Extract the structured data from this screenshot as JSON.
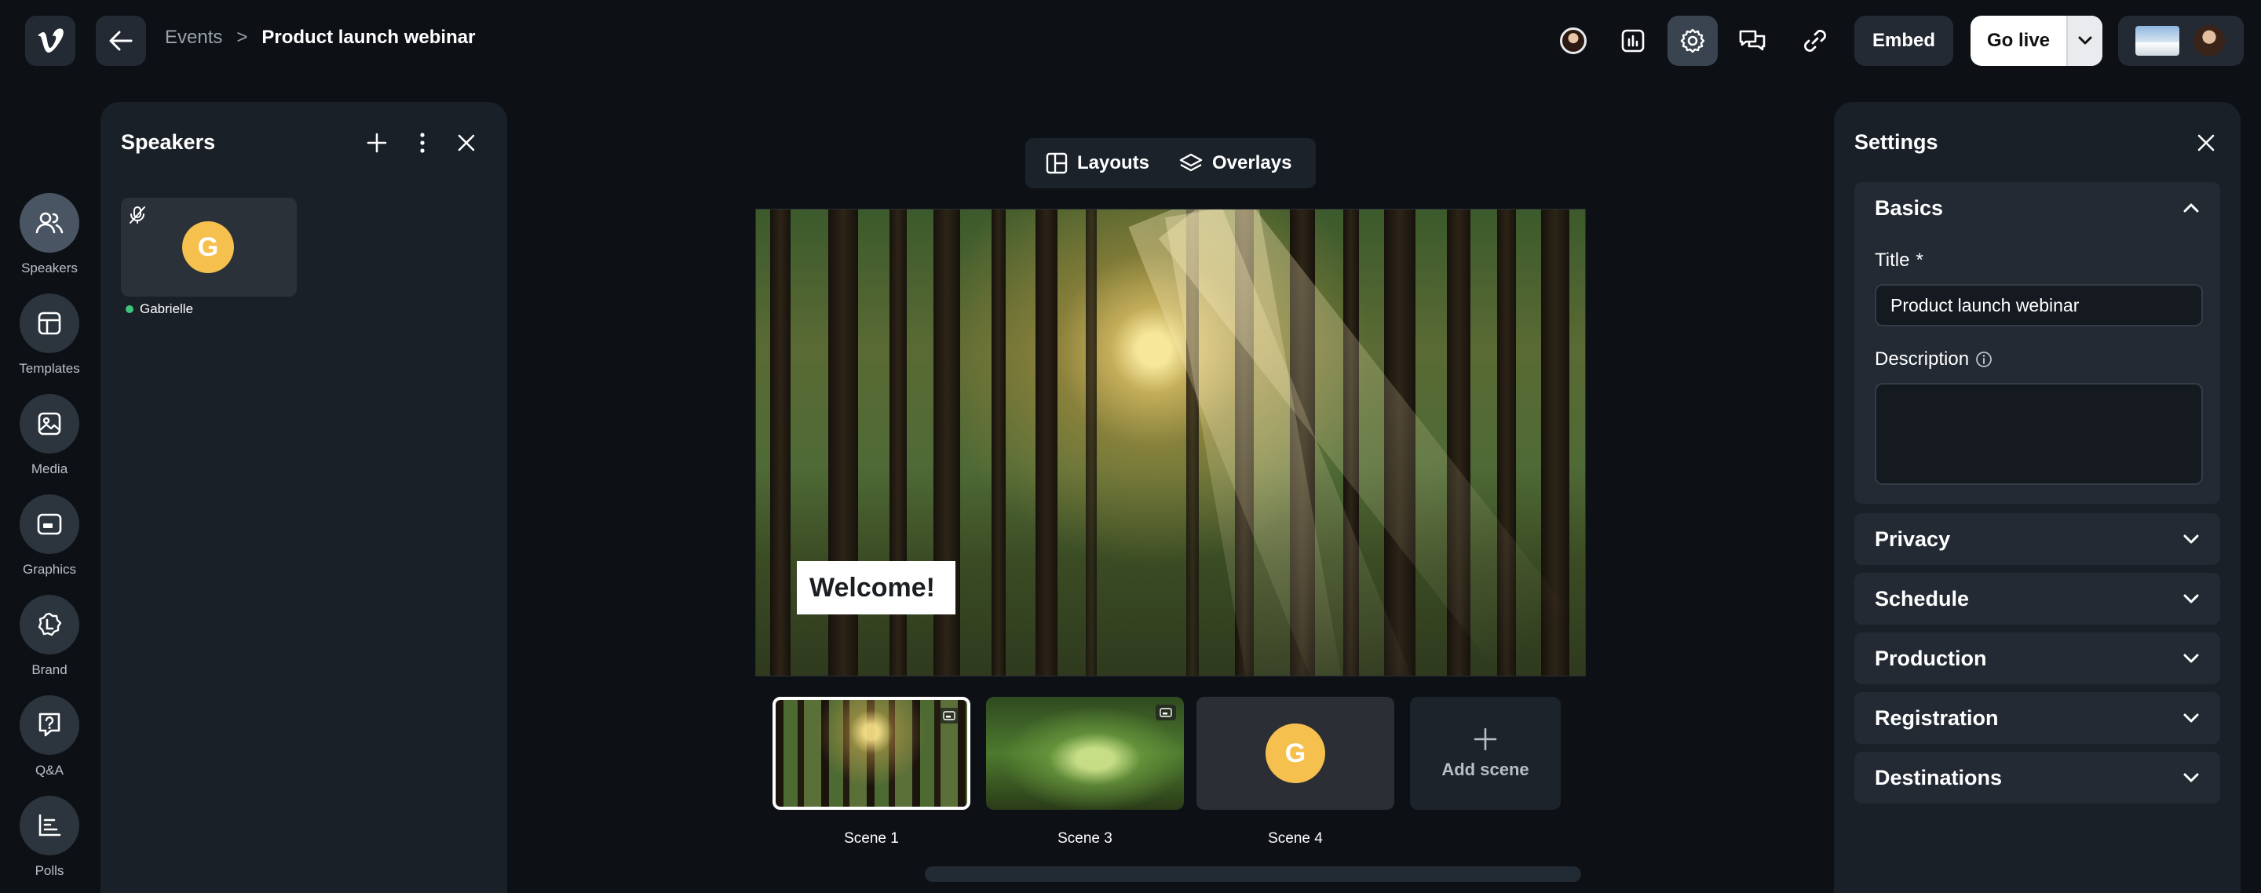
{
  "header": {
    "breadcrumb_parent": "Events",
    "breadcrumb_sep": ">",
    "breadcrumb_current": "Product launch webinar",
    "embed_label": "Embed",
    "golive_label": "Go live"
  },
  "rail": {
    "items": [
      {
        "label": "Speakers",
        "icon": "users-icon"
      },
      {
        "label": "Templates",
        "icon": "template-icon"
      },
      {
        "label": "Media",
        "icon": "image-icon"
      },
      {
        "label": "Graphics",
        "icon": "graphics-icon"
      },
      {
        "label": "Brand",
        "icon": "brand-icon"
      },
      {
        "label": "Q&A",
        "icon": "qa-icon"
      },
      {
        "label": "Polls",
        "icon": "polls-icon"
      }
    ]
  },
  "speakers": {
    "title": "Speakers",
    "list": [
      {
        "initial": "G",
        "name": "Gabrielle",
        "status": "online"
      }
    ]
  },
  "stage": {
    "tabs": [
      "Layouts",
      "Overlays"
    ],
    "overlay_text": "Welcome!"
  },
  "scenes": {
    "items": [
      {
        "label": "Scene 1"
      },
      {
        "label": "Scene 3"
      },
      {
        "label": "Scene 4",
        "initial": "G"
      }
    ],
    "add_label": "Add scene"
  },
  "settings": {
    "title": "Settings",
    "basics_title": "Basics",
    "title_label": "Title",
    "required_mark": "*",
    "title_value": "Product launch webinar",
    "description_label": "Description",
    "description_value": "",
    "sections": [
      "Privacy",
      "Schedule",
      "Production",
      "Registration",
      "Destinations"
    ]
  },
  "colors": {
    "background": "#0d1116",
    "panel": "#1a2028",
    "accent_avatar": "#f6c04e",
    "online": "#3ec47a"
  }
}
